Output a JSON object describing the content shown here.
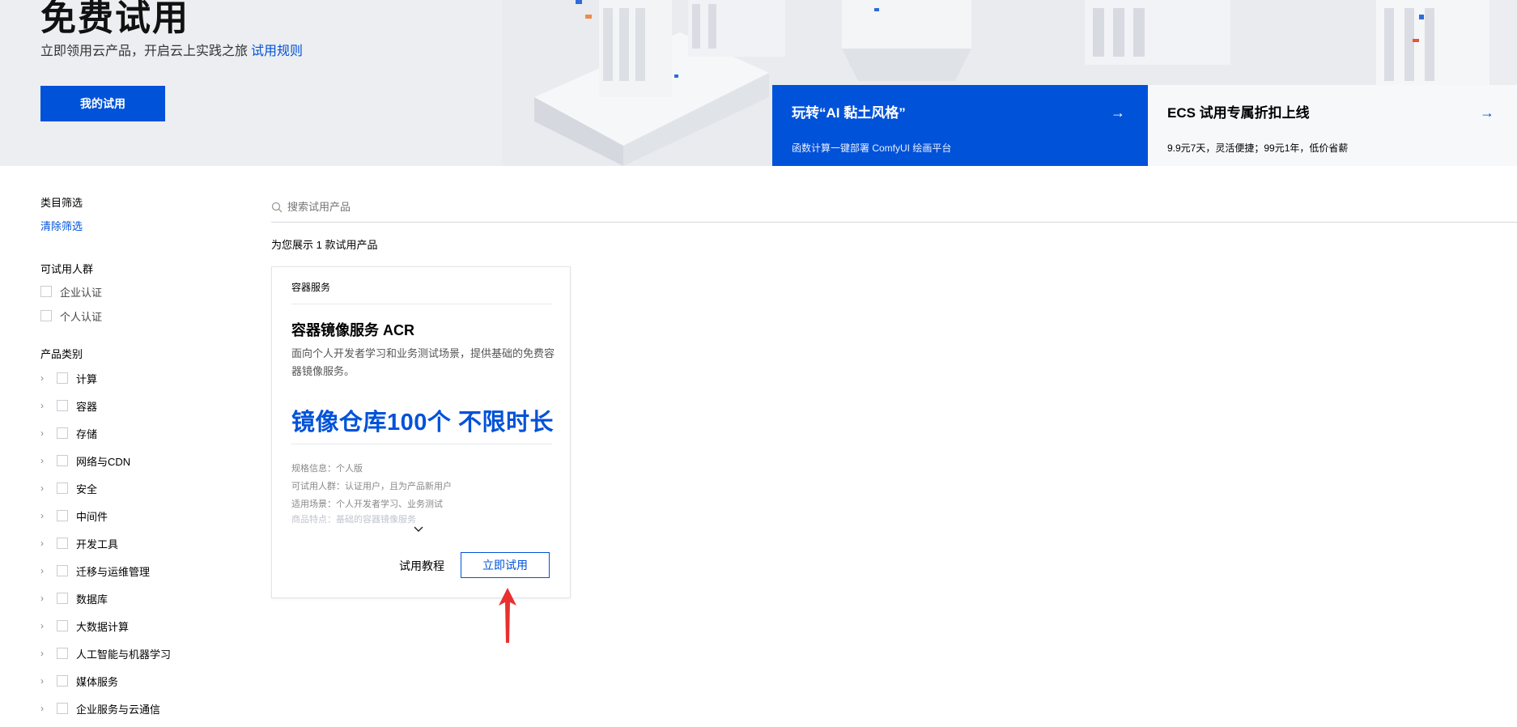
{
  "hero": {
    "title": "免费试用",
    "subtitle": "立即领用云产品，开启云上实践之旅",
    "rules_link": "试用规则",
    "my_trial_button": "我的试用"
  },
  "promos": [
    {
      "title": "玩转“AI 黏土风格”",
      "desc": "函数计算一键部署 ComfyUI 绘画平台",
      "arrow": "→"
    },
    {
      "title": "ECS 试用专属折扣上线",
      "desc": "9.9元7天，灵活便捷；99元1年，低价省薪",
      "arrow": "→"
    }
  ],
  "sidebar": {
    "filter_title": "类目筛选",
    "clear_filter": "清除筛选",
    "audience_title": "可试用人群",
    "audience": [
      "企业认证",
      "个人认证"
    ],
    "category_title": "产品类别",
    "categories": [
      "计算",
      "容器",
      "存储",
      "网络与CDN",
      "安全",
      "中间件",
      "开发工具",
      "迁移与运维管理",
      "数据库",
      "大数据计算",
      "人工智能与机器学习",
      "媒体服务",
      "企业服务与云通信"
    ]
  },
  "search": {
    "placeholder": "搜索试用产品"
  },
  "result_count": "为您展示 1 款试用产品",
  "card": {
    "category": "容器服务",
    "title": "容器镜像服务 ACR",
    "description": "面向个人开发者学习和业务测试场景，提供基础的免费容器镜像服务。",
    "highlight": "镜像仓库100个 不限时长",
    "specs": [
      "规格信息：个人版",
      "可试用人群：认证用户，且为产品新用户",
      "适用场景：个人开发者学习、业务测试",
      "商品特点：基础的容器镜像服务"
    ],
    "tutorial_label": "试用教程",
    "try_button": "立即试用"
  },
  "colors": {
    "primary": "#0052d9",
    "annotation": "#e8302f"
  }
}
